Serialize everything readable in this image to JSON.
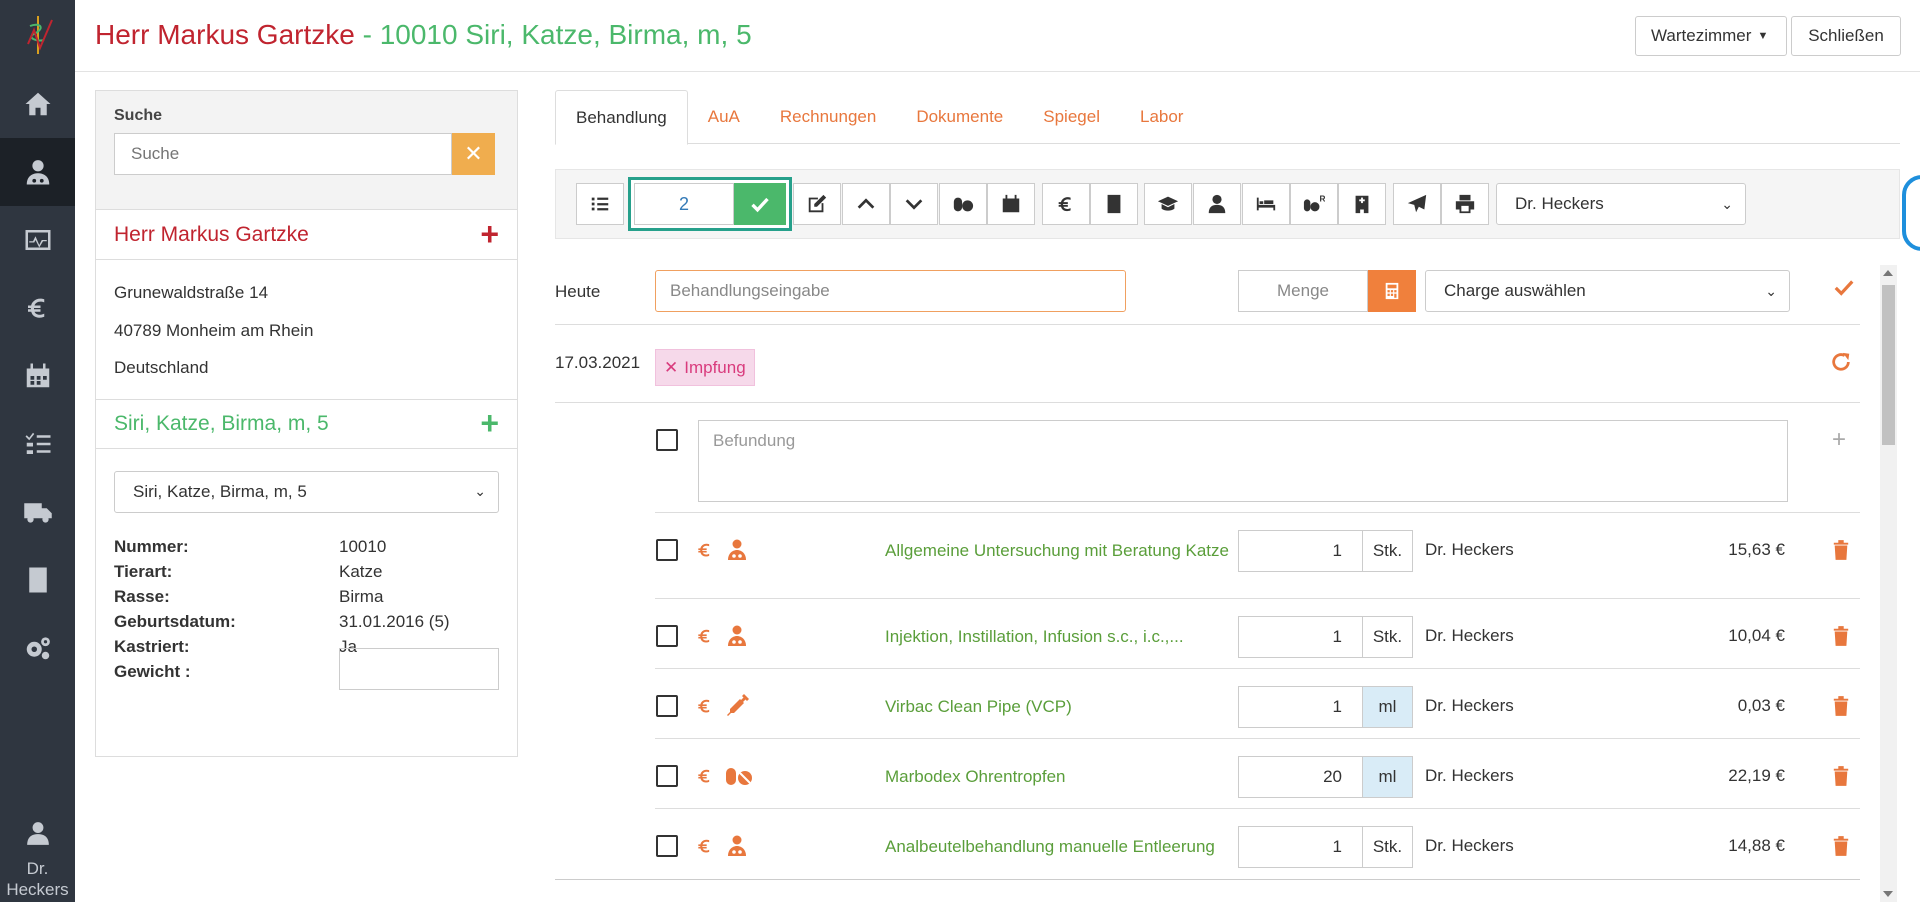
{
  "header": {
    "owner": "Herr Markus Gartzke",
    "pet": " - 10010 Siri, Katze, Birma, m, 5",
    "waiting_room_label": "Wartezimmer",
    "close_label": "Schließen"
  },
  "sidebar": {
    "items": [
      {
        "icon": "home-icon"
      },
      {
        "icon": "patient-icon"
      },
      {
        "icon": "monitor-icon"
      },
      {
        "icon": "euro-icon"
      },
      {
        "icon": "calendar-icon"
      },
      {
        "icon": "checklist-icon"
      },
      {
        "icon": "truck-icon"
      },
      {
        "icon": "book-icon"
      },
      {
        "icon": "settings-icon"
      }
    ],
    "user_line1": "Dr.",
    "user_line2": "Heckers"
  },
  "search": {
    "label": "Suche",
    "placeholder": "Suche"
  },
  "owner": {
    "name": "Herr Markus Gartzke",
    "street": "Grunewaldstraße 14",
    "city": "40789 Monheim am Rhein",
    "country": "Deutschland"
  },
  "pet": {
    "heading": "Siri, Katze, Birma, m, 5",
    "select_value": "Siri, Katze, Birma, m, 5",
    "details": [
      {
        "key": "Nummer:",
        "value": "10010"
      },
      {
        "key": "Tierart:",
        "value": "Katze"
      },
      {
        "key": "Rasse:",
        "value": "Birma"
      },
      {
        "key": "Geburtsdatum:",
        "value": "31.01.2016  (5)"
      },
      {
        "key": "Kastriert:",
        "value": "Ja"
      },
      {
        "key": "Gewicht :",
        "value": ""
      }
    ]
  },
  "tabs": [
    "Behandlung",
    "AuA",
    "Rechnungen",
    "Dokumente",
    "Spiegel",
    "Labor"
  ],
  "toolbar": {
    "counter_value": "2",
    "doctor": "Dr. Heckers"
  },
  "entry": {
    "today_label": "Heute",
    "treatment_placeholder": "Behandlungseingabe",
    "amount_placeholder": "Menge",
    "charge_placeholder": "Charge auswählen"
  },
  "session": {
    "date": "17.03.2021",
    "badge": "Impfung",
    "findings_placeholder": "Befundung"
  },
  "items": [
    {
      "name": "Allgemeine Untersuchung mit Beratung Katze",
      "qty": "1",
      "unit": "Stk.",
      "doctor": "Dr. Heckers",
      "price": "15,63 €",
      "icon": "vet-icon"
    },
    {
      "name": "Injektion, Instillation, Infusion s.c., i.c.,...",
      "qty": "1",
      "unit": "Stk.",
      "doctor": "Dr. Heckers",
      "price": "10,04 €",
      "icon": "vet-icon"
    },
    {
      "name": "Virbac Clean Pipe (VCP)",
      "qty": "1",
      "unit": "ml",
      "doctor": "Dr. Heckers",
      "price": "0,03 €",
      "icon": "syringe-icon"
    },
    {
      "name": "Marbodex Ohrentropfen",
      "qty": "20",
      "unit": "ml",
      "doctor": "Dr. Heckers",
      "price": "22,19 €",
      "icon": "pills-icon"
    },
    {
      "name": "Analbeutelbehandlung manuelle Entleerung",
      "qty": "1",
      "unit": "Stk.",
      "doctor": "Dr. Heckers",
      "price": "14,88 €",
      "icon": "vet-icon"
    }
  ],
  "colors": {
    "sidebar": "#2f3640",
    "owner_red": "#c0242f",
    "pet_green": "#4bb86b",
    "accent_orange": "#e8773d",
    "highlight_teal": "#26a08b"
  }
}
